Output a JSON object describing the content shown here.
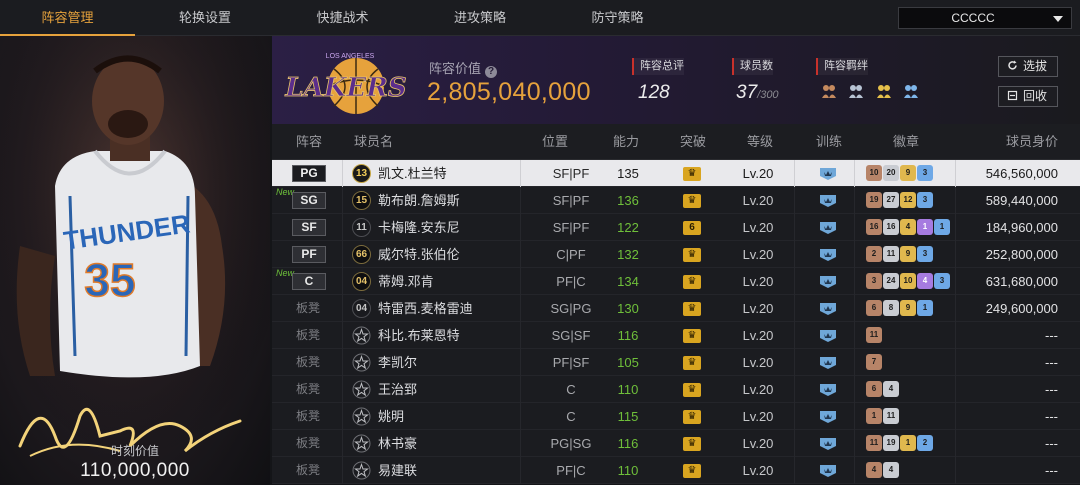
{
  "nav": {
    "tabs": [
      "阵容管理",
      "轮换设置",
      "快捷战术",
      "进攻策略",
      "防守策略"
    ],
    "active_tab": 0,
    "team_select": "CCCCC"
  },
  "card": {
    "jersey_team": "THUNDER",
    "jersey_number": "35",
    "market_value_label": "时刻价值",
    "market_value": "110,000,000"
  },
  "team": {
    "logo_text": "LAKERS",
    "logo_city": "LOS ANGELES",
    "lineup_value_label": "阵容价值",
    "lineup_value": "2,805,040,000",
    "rating_label": "阵容总评",
    "rating": "128",
    "player_count_label": "球员数",
    "player_count": "37",
    "player_count_max": "/300",
    "bonds_label": "阵容羁绊",
    "select_button": "选拔",
    "recycle_button": "回收"
  },
  "table": {
    "headers": [
      "阵容",
      "球员名",
      "位置",
      "能力",
      "突破",
      "等级",
      "训练",
      "徽章",
      "球员身价"
    ],
    "rows": [
      {
        "slot": "PG",
        "new": "",
        "number": "13",
        "numstyle": "gold",
        "name": "凯文.杜兰特",
        "pos": "SF|PF",
        "power": "135",
        "brk": "♛",
        "level": "Lv.20",
        "badges": [
          [
            "10",
            "bronze"
          ],
          [
            "20",
            "silver"
          ],
          [
            "9",
            "gold"
          ],
          [
            "3",
            "blue"
          ]
        ],
        "value": "546,560,000",
        "selected": true
      },
      {
        "slot": "SG",
        "new": "New",
        "number": "15",
        "numstyle": "gold",
        "name": "勒布朗.詹姆斯",
        "pos": "SF|PF",
        "power": "136",
        "brk": "♛",
        "level": "Lv.20",
        "badges": [
          [
            "19",
            "bronze"
          ],
          [
            "27",
            "silver"
          ],
          [
            "12",
            "gold"
          ],
          [
            "3",
            "blue"
          ]
        ],
        "value": "589,440,000"
      },
      {
        "slot": "SF",
        "new": "",
        "number": "11",
        "numstyle": "plain",
        "name": "卡梅隆.安东尼",
        "pos": "SF|PF",
        "power": "122",
        "brk": "6",
        "level": "Lv.20",
        "badges": [
          [
            "16",
            "bronze"
          ],
          [
            "16",
            "silver"
          ],
          [
            "4",
            "gold"
          ],
          [
            "1",
            "purple"
          ],
          [
            "1",
            "blue"
          ]
        ],
        "value": "184,960,000"
      },
      {
        "slot": "PF",
        "new": "",
        "number": "66",
        "numstyle": "gold",
        "name": "威尔特.张伯伦",
        "pos": "C|PF",
        "power": "132",
        "brk": "♛",
        "level": "Lv.20",
        "badges": [
          [
            "2",
            "bronze"
          ],
          [
            "11",
            "silver"
          ],
          [
            "9",
            "gold"
          ],
          [
            "3",
            "blue"
          ]
        ],
        "value": "252,800,000"
      },
      {
        "slot": "C",
        "new": "New",
        "number": "04",
        "numstyle": "gold",
        "name": "蒂姆.邓肯",
        "pos": "PF|C",
        "power": "134",
        "brk": "♛",
        "level": "Lv.20",
        "badges": [
          [
            "3",
            "bronze"
          ],
          [
            "24",
            "silver"
          ],
          [
            "10",
            "gold"
          ],
          [
            "4",
            "purple"
          ],
          [
            "3",
            "blue"
          ]
        ],
        "value": "631,680,000"
      },
      {
        "slot": "板凳",
        "new": "",
        "number": "04",
        "numstyle": "plain",
        "name": "特雷西.麦格雷迪",
        "pos": "SG|PG",
        "power": "130",
        "brk": "♛",
        "level": "Lv.20",
        "badges": [
          [
            "6",
            "bronze"
          ],
          [
            "8",
            "silver"
          ],
          [
            "9",
            "gold"
          ],
          [
            "1",
            "blue"
          ]
        ],
        "value": "249,600,000"
      },
      {
        "slot": "板凳",
        "new": "",
        "number": "☆",
        "numstyle": "star",
        "name": "科比.布莱恩特",
        "pos": "SG|SF",
        "power": "116",
        "brk": "♛",
        "level": "Lv.20",
        "badges": [
          [
            "11",
            "bronze"
          ]
        ],
        "value": "---"
      },
      {
        "slot": "板凳",
        "new": "",
        "number": "☆",
        "numstyle": "star",
        "name": "李凯尔",
        "pos": "PF|SF",
        "power": "105",
        "brk": "♛",
        "level": "Lv.20",
        "badges": [
          [
            "7",
            "bronze"
          ]
        ],
        "value": "---"
      },
      {
        "slot": "板凳",
        "new": "",
        "number": "☆",
        "numstyle": "star",
        "name": "王治郅",
        "pos": "C",
        "power": "110",
        "brk": "♛",
        "level": "Lv.20",
        "badges": [
          [
            "6",
            "bronze"
          ],
          [
            "4",
            "silver"
          ]
        ],
        "value": "---"
      },
      {
        "slot": "板凳",
        "new": "",
        "number": "☆",
        "numstyle": "star",
        "name": "姚明",
        "pos": "C",
        "power": "115",
        "brk": "♛",
        "level": "Lv.20",
        "badges": [
          [
            "1",
            "bronze"
          ],
          [
            "11",
            "silver"
          ]
        ],
        "value": "---"
      },
      {
        "slot": "板凳",
        "new": "",
        "number": "☆",
        "numstyle": "star",
        "name": "林书豪",
        "pos": "PG|SG",
        "power": "116",
        "brk": "♛",
        "level": "Lv.20",
        "badges": [
          [
            "11",
            "bronze"
          ],
          [
            "19",
            "silver"
          ],
          [
            "1",
            "gold"
          ],
          [
            "2",
            "blue"
          ]
        ],
        "value": "---"
      },
      {
        "slot": "板凳",
        "new": "",
        "number": "☆",
        "numstyle": "star",
        "name": "易建联",
        "pos": "PF|C",
        "power": "110",
        "brk": "♛",
        "level": "Lv.20",
        "badges": [
          [
            "4",
            "bronze"
          ],
          [
            "4",
            "silver"
          ]
        ],
        "value": "---"
      }
    ]
  },
  "colors": {
    "accent": "#e6a23c",
    "power_green": "#6fbf3a",
    "new_tag": "#6ec23a",
    "stat_marker": "#c8312b"
  },
  "icons": [
    "help-icon",
    "bond-icon",
    "refresh-icon",
    "recycle-icon",
    "crown-icon",
    "training-icon",
    "dropdown-caret-icon"
  ]
}
